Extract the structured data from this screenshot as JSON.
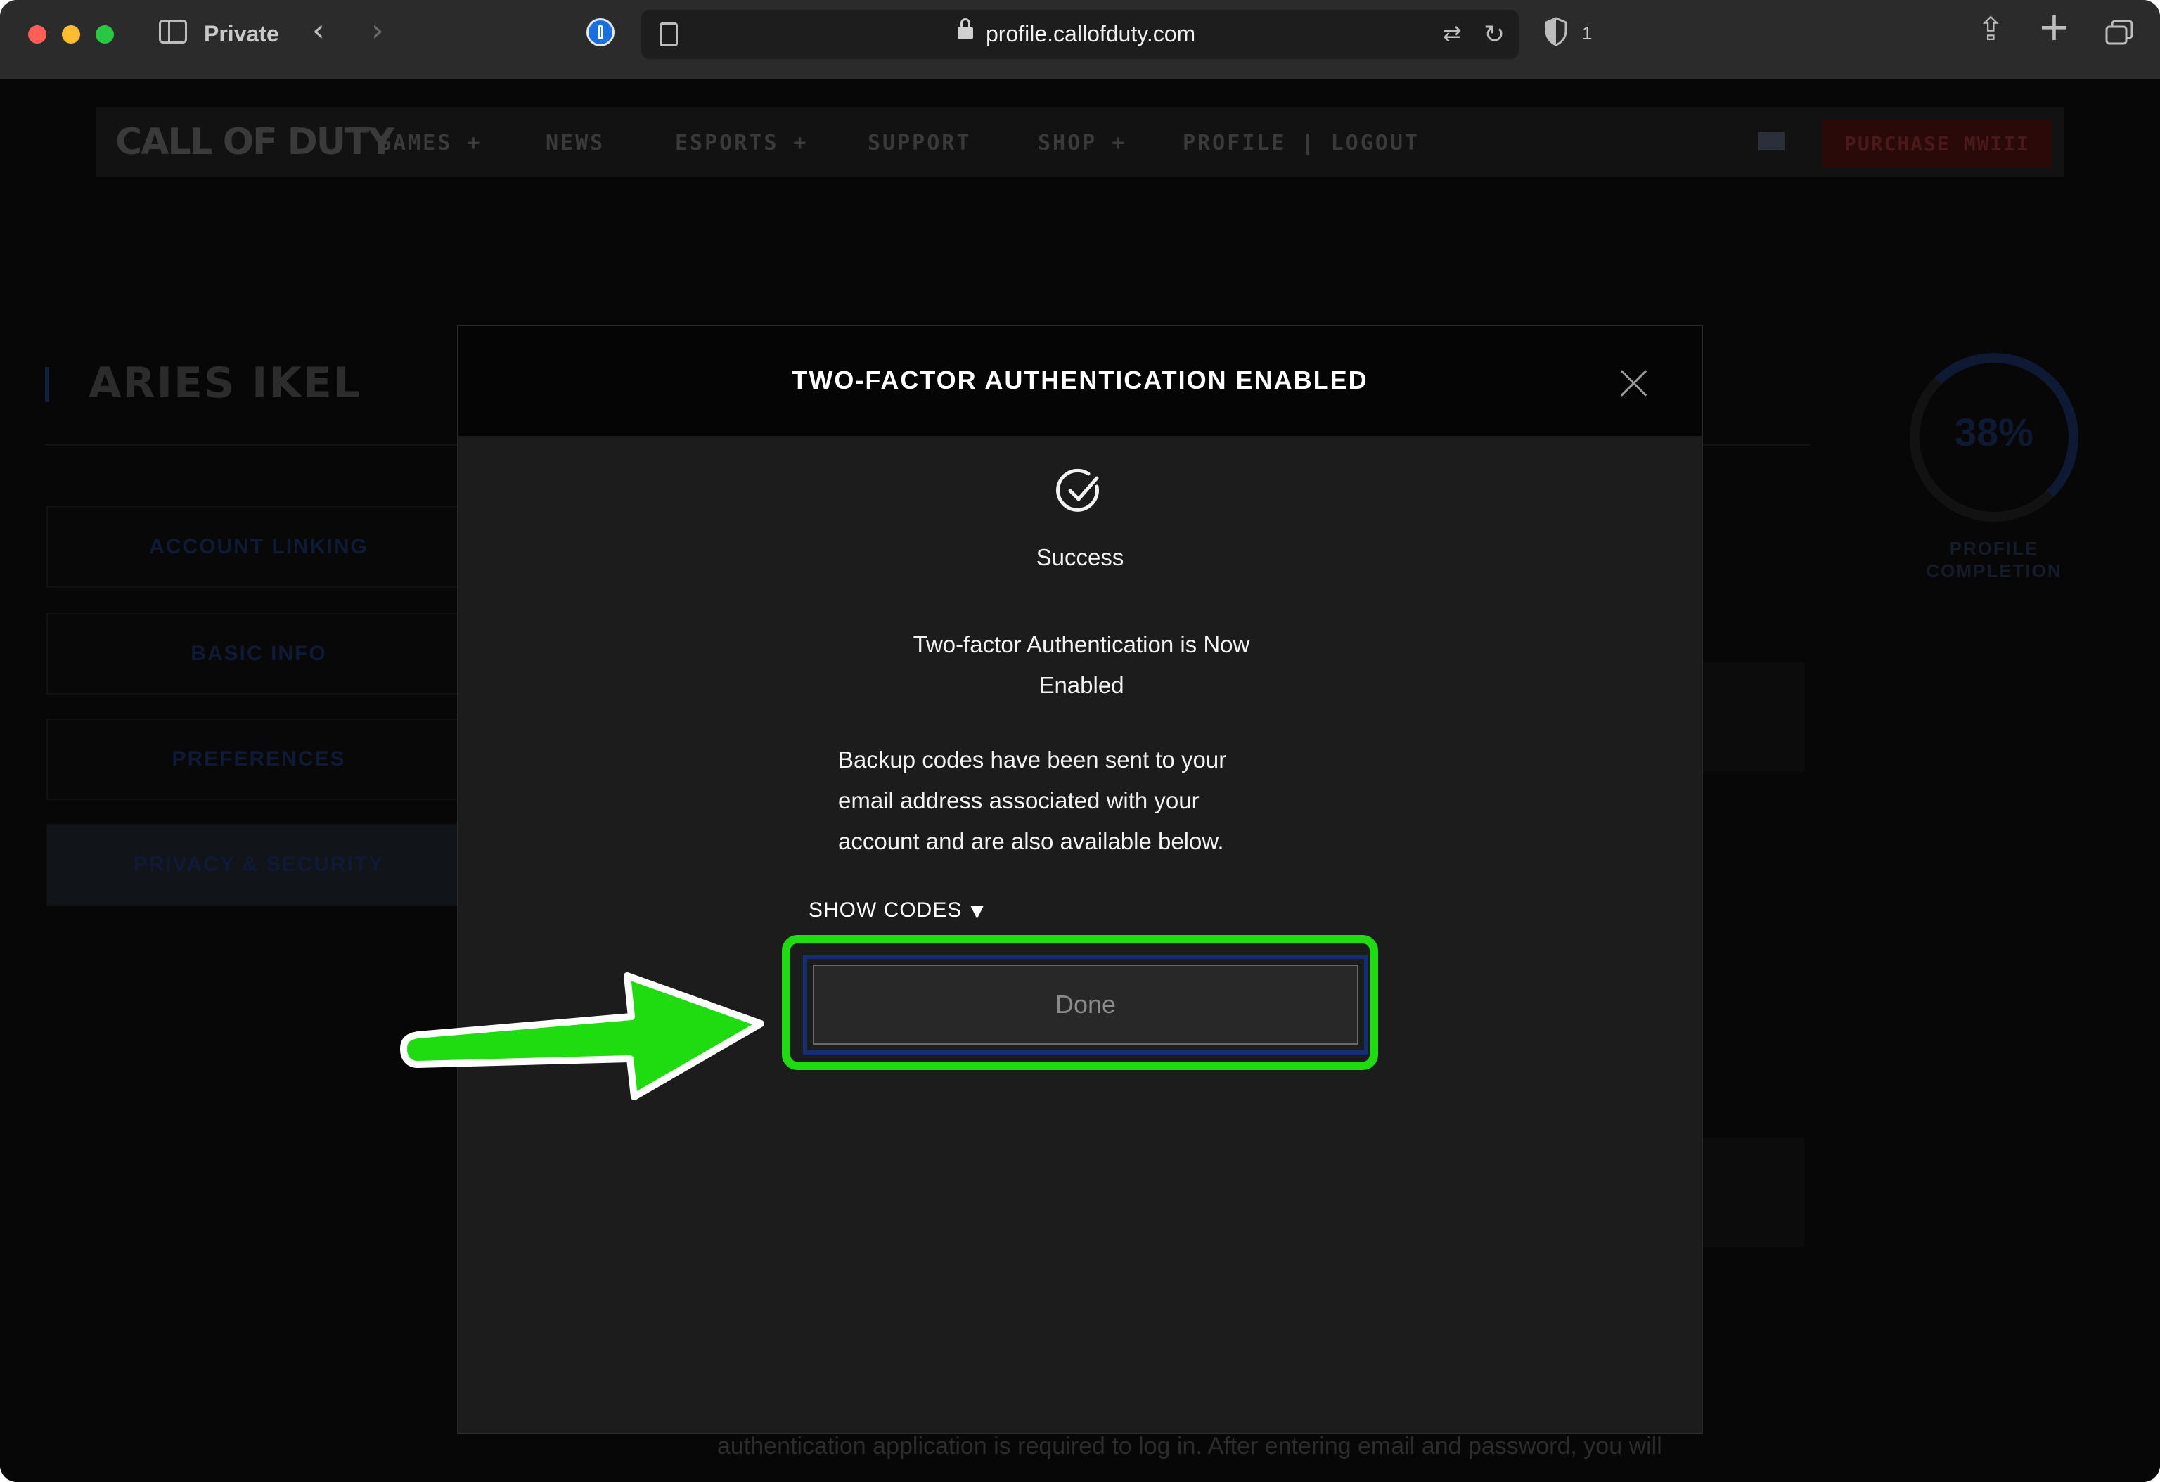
{
  "browser": {
    "mode_label": "Private",
    "url": "profile.callofduty.com",
    "tracker_count": "1"
  },
  "site": {
    "logo": "CALL OF DUTY",
    "nav": [
      "GAMES  +",
      "NEWS",
      "ESPORTS  +",
      "SUPPORT",
      "SHOP  +",
      "PROFILE  |  LOGOUT"
    ],
    "purchase_label": "PURCHASE MWIII",
    "profile_name": "ARIES IKEL",
    "sidebar": [
      "ACCOUNT LINKING",
      "BASIC INFO",
      "PREFERENCES",
      "PRIVACY & SECURITY"
    ],
    "completion_percent": "38%",
    "completion_label": "PROFILE COMPLETION",
    "bottom_text": "authentication application is required to log in. After entering email and password, you will"
  },
  "modal": {
    "title": "TWO-FACTOR AUTHENTICATION ENABLED",
    "status": "Success",
    "enabled_message": "Two-factor Authentication is Now Enabled",
    "backup_message": "Backup codes have been sent to your email address associated with your account and are also available below.",
    "show_codes_label": "SHOW CODES",
    "show_codes_caret": "▼",
    "done_label": "Done"
  },
  "colors": {
    "highlight": "#1fdc11",
    "arrow": "#1fdc11",
    "modal_bg": "#1c1c1c"
  }
}
